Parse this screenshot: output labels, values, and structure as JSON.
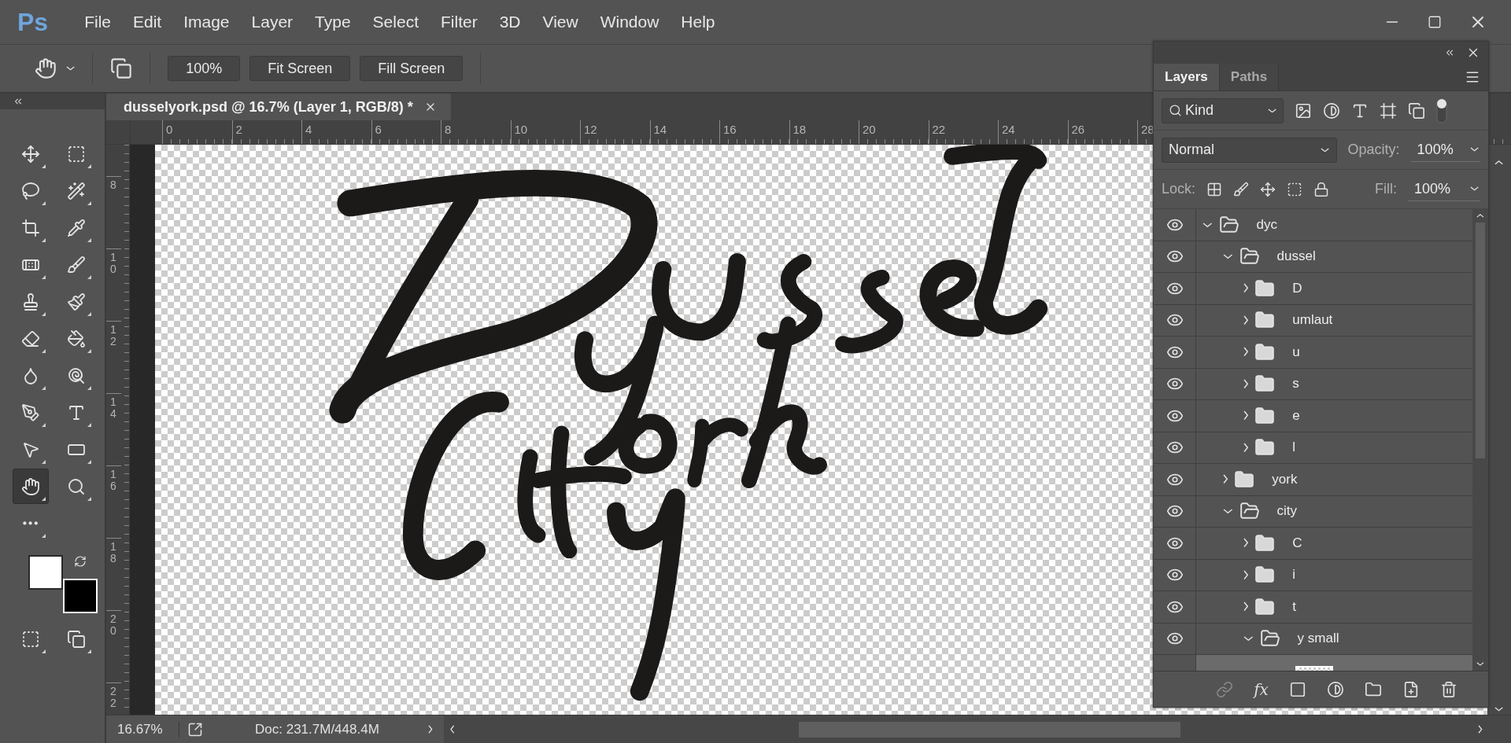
{
  "app": {
    "logo": "Ps"
  },
  "menu": [
    "File",
    "Edit",
    "Image",
    "Layer",
    "Type",
    "Select",
    "Filter",
    "3D",
    "View",
    "Window",
    "Help"
  ],
  "options_bar": {
    "buttons": [
      "100%",
      "Fit Screen",
      "Fill Screen"
    ]
  },
  "tools": [
    {
      "kind": "move",
      "selected": false
    },
    {
      "kind": "marquee",
      "selected": false
    },
    {
      "kind": "lasso",
      "selected": false
    },
    {
      "kind": "wand",
      "selected": false
    },
    {
      "kind": "crop",
      "selected": false
    },
    {
      "kind": "eyedropper",
      "selected": false
    },
    {
      "kind": "healing",
      "selected": false
    },
    {
      "kind": "brush",
      "selected": false
    },
    {
      "kind": "stamp",
      "selected": false
    },
    {
      "kind": "history",
      "selected": false
    },
    {
      "kind": "eraser",
      "selected": false
    },
    {
      "kind": "bucket",
      "selected": false
    },
    {
      "kind": "blur",
      "selected": false
    },
    {
      "kind": "dodge",
      "selected": false
    },
    {
      "kind": "pen",
      "selected": false
    },
    {
      "kind": "type",
      "selected": false
    },
    {
      "kind": "select",
      "selected": false
    },
    {
      "kind": "rectangle",
      "selected": false
    },
    {
      "kind": "hand",
      "selected": true
    },
    {
      "kind": "zoom",
      "selected": false
    },
    {
      "kind": "more",
      "selected": false
    }
  ],
  "swatches": [
    {
      "kind": "foreground",
      "color": "#ffffff"
    },
    {
      "kind": "background",
      "color": "#000000"
    }
  ],
  "document": {
    "tab_title": "dusselyork.psd @ 16.7% (Layer 1, RGB/8) *",
    "ruler_h": [
      "0",
      "2",
      "4",
      "6",
      "8",
      "10",
      "12",
      "14",
      "16",
      "18",
      "20",
      "22",
      "24",
      "26",
      "28"
    ],
    "ruler_v": [
      "8",
      "10",
      "12",
      "14",
      "16",
      "18",
      "20",
      "22"
    ]
  },
  "status_bar": {
    "zoom": "16.67%",
    "doc_info": "Doc: 231.7M/448.4M"
  },
  "layers_panel": {
    "tabs": [
      {
        "label": "Layers",
        "selected": true
      },
      {
        "label": "Paths",
        "selected": false
      }
    ],
    "filter": "Kind",
    "effects_label": "fx",
    "blend_mode": "Normal",
    "opacity_label": "Opacity:",
    "opacity": "100%",
    "lock_label": "Lock:",
    "fill_label": "Fill:",
    "fill": "100%",
    "items": [
      {
        "kind": "group",
        "name": "dyc",
        "visible": true,
        "expanded": true,
        "selected": false,
        "children": [
          {
            "kind": "group",
            "name": "dussel",
            "visible": true,
            "expanded": true,
            "selected": false,
            "children": [
              {
                "kind": "group",
                "name": "D",
                "visible": true,
                "expanded": false,
                "selected": false
              },
              {
                "kind": "group",
                "name": "umlaut",
                "visible": true,
                "expanded": false,
                "selected": false
              },
              {
                "kind": "group",
                "name": "u",
                "visible": true,
                "expanded": false,
                "selected": false
              },
              {
                "kind": "group",
                "name": "s",
                "visible": true,
                "expanded": false,
                "selected": false
              },
              {
                "kind": "group",
                "name": "e",
                "visible": true,
                "expanded": false,
                "selected": false
              },
              {
                "kind": "group",
                "name": "l",
                "visible": true,
                "expanded": false,
                "selected": false
              }
            ]
          },
          {
            "kind": "group",
            "name": "york",
            "visible": true,
            "expanded": false,
            "selected": false
          },
          {
            "kind": "group",
            "name": "city",
            "visible": true,
            "expanded": true,
            "selected": false,
            "children": [
              {
                "kind": "group",
                "name": "C",
                "visible": true,
                "expanded": false,
                "selected": false
              },
              {
                "kind": "group",
                "name": "i",
                "visible": true,
                "expanded": false,
                "selected": false
              },
              {
                "kind": "group",
                "name": "t",
                "visible": true,
                "expanded": false,
                "selected": false
              },
              {
                "kind": "group",
                "name": "y small",
                "visible": true,
                "expanded": true,
                "selected": false,
                "children": [
                  {
                    "kind": "layer",
                    "visible": false,
                    "selected": true
                  }
                ]
              }
            ]
          }
        ]
      }
    ]
  }
}
